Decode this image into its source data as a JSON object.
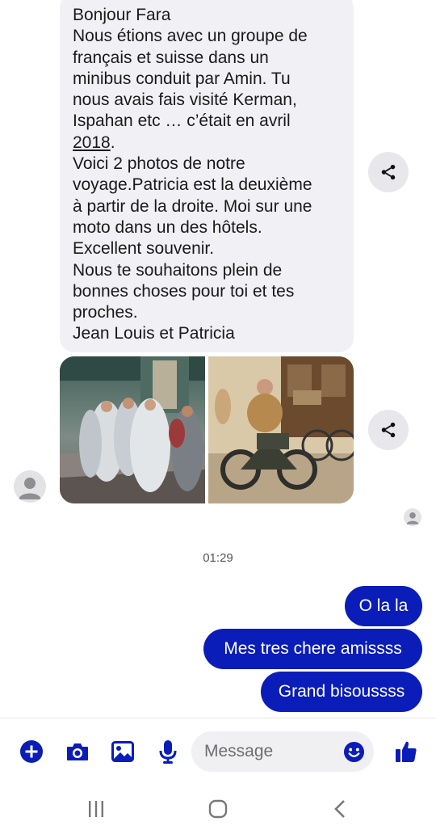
{
  "incoming_message": {
    "lines": [
      "Bonjour Fara",
      "Nous étions avec un groupe de",
      "français et suisse dans un",
      "minibus conduit par Amin. Tu",
      "nous avais fais visité Kerman,",
      "Ispahan etc … c’était en avril",
      "2018",
      "Voici 2 photos de notre",
      "voyage.Patricia est la deuxième",
      "à partir de la droite. Moi sur une",
      "moto dans un des hôtels.",
      "Excellent souvenir.",
      "Nous te souhaitons plein de",
      "bonnes choses pour toi et tes",
      "proches.",
      "Jean Louis et Patricia"
    ],
    "line7_suffix": "."
  },
  "timestamp": "01:29",
  "outgoing_messages": [
    {
      "text": "O la la"
    },
    {
      "text": "Mes tres chere amissss"
    },
    {
      "text": "Grand bisoussss"
    }
  ],
  "composer": {
    "placeholder": "Message"
  },
  "icons": {
    "add": "plus-circle-icon",
    "camera": "camera-icon",
    "gallery": "image-icon",
    "voice": "microphone-icon",
    "emoji": "emoji-icon",
    "like": "thumbs-up-icon",
    "share": "share-icon"
  },
  "colors": {
    "accent": "#0b1db8",
    "incoming_bubble": "#f1f1f5"
  }
}
